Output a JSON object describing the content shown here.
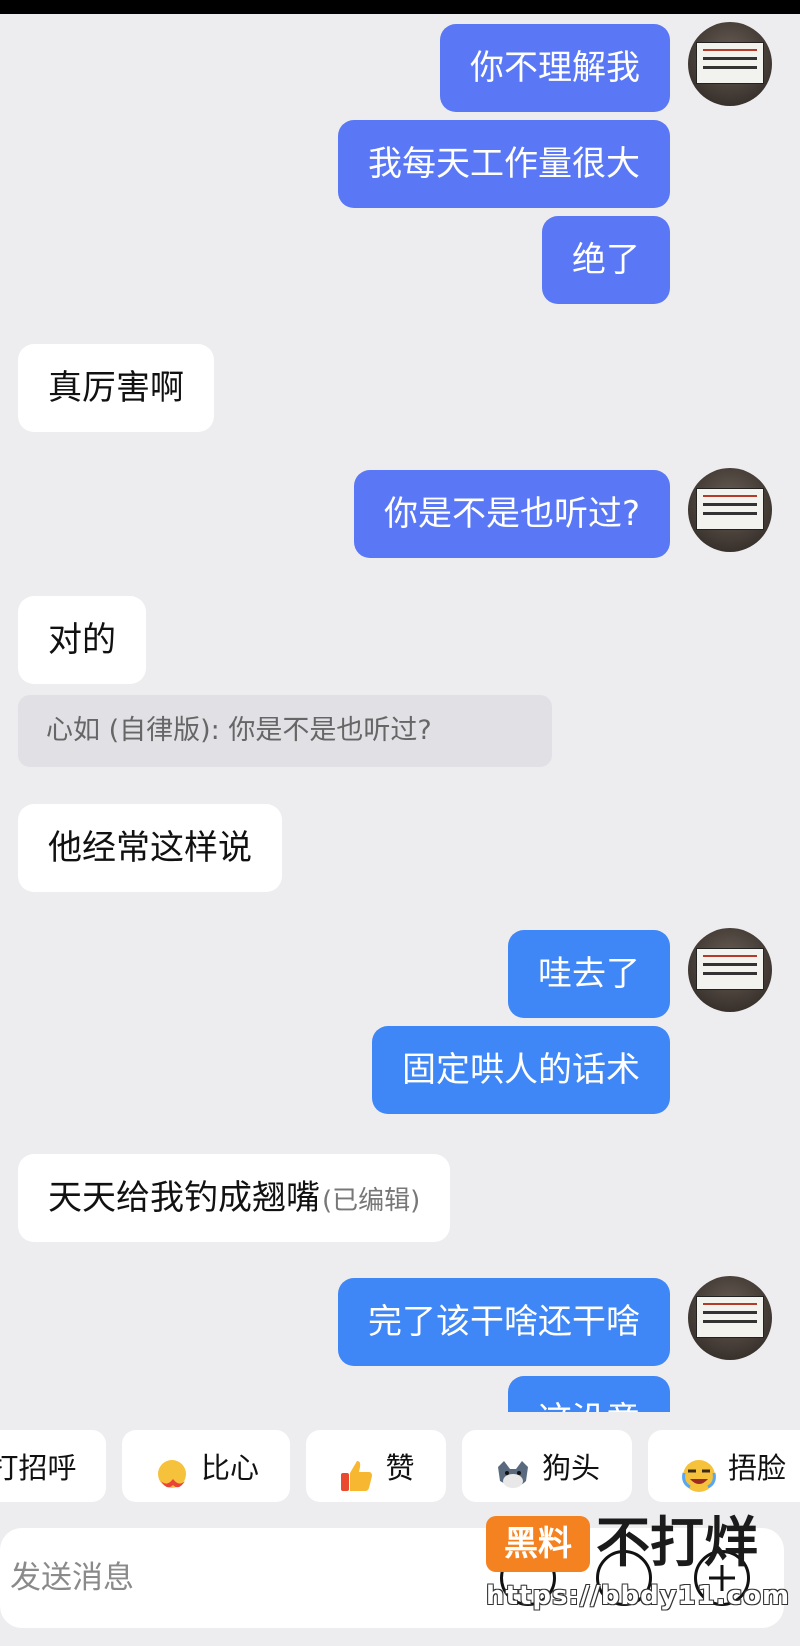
{
  "colors": {
    "outgoing_bubble": "#5a78f5",
    "outgoing_bubble_alt": "#3f86f7",
    "incoming_bubble": "#ffffff",
    "background": "#ededf0",
    "watermark_orange": "#f58220"
  },
  "messages": [
    {
      "side": "out",
      "text": "你不理解我"
    },
    {
      "side": "out",
      "text": "我每天工作量很大"
    },
    {
      "side": "out",
      "text": "绝了"
    },
    {
      "side": "in",
      "text": "真厉害啊"
    },
    {
      "side": "out",
      "text": "你是不是也听过?"
    },
    {
      "side": "in",
      "text": "对的"
    },
    {
      "side": "in",
      "text": "他经常这样说"
    },
    {
      "side": "out",
      "text": "哇去了"
    },
    {
      "side": "out",
      "text": "固定哄人的话术"
    },
    {
      "side": "in",
      "text": "天天给我钓成翘嘴",
      "edited_tag": "(已编辑)"
    },
    {
      "side": "out",
      "text": "完了该干啥还干啥"
    },
    {
      "side": "out",
      "text": "这没意"
    }
  ],
  "quote": {
    "text": "心如 (自律版): 你是不是也听过?"
  },
  "avatar_icon": "avatar-photo-sign",
  "reactions": [
    {
      "label": "打招呼",
      "icon": "wave-icon"
    },
    {
      "label": "比心",
      "icon": "heart-hands-icon"
    },
    {
      "label": "赞",
      "icon": "thumbs-up-icon"
    },
    {
      "label": "狗头",
      "icon": "dog-head-icon"
    },
    {
      "label": "捂脸",
      "icon": "facepalm-icon"
    }
  ],
  "input": {
    "placeholder": "发送消息"
  },
  "watermark": {
    "badge": "黑料",
    "text": "不打烊",
    "url": "https://bbdy11.com"
  }
}
